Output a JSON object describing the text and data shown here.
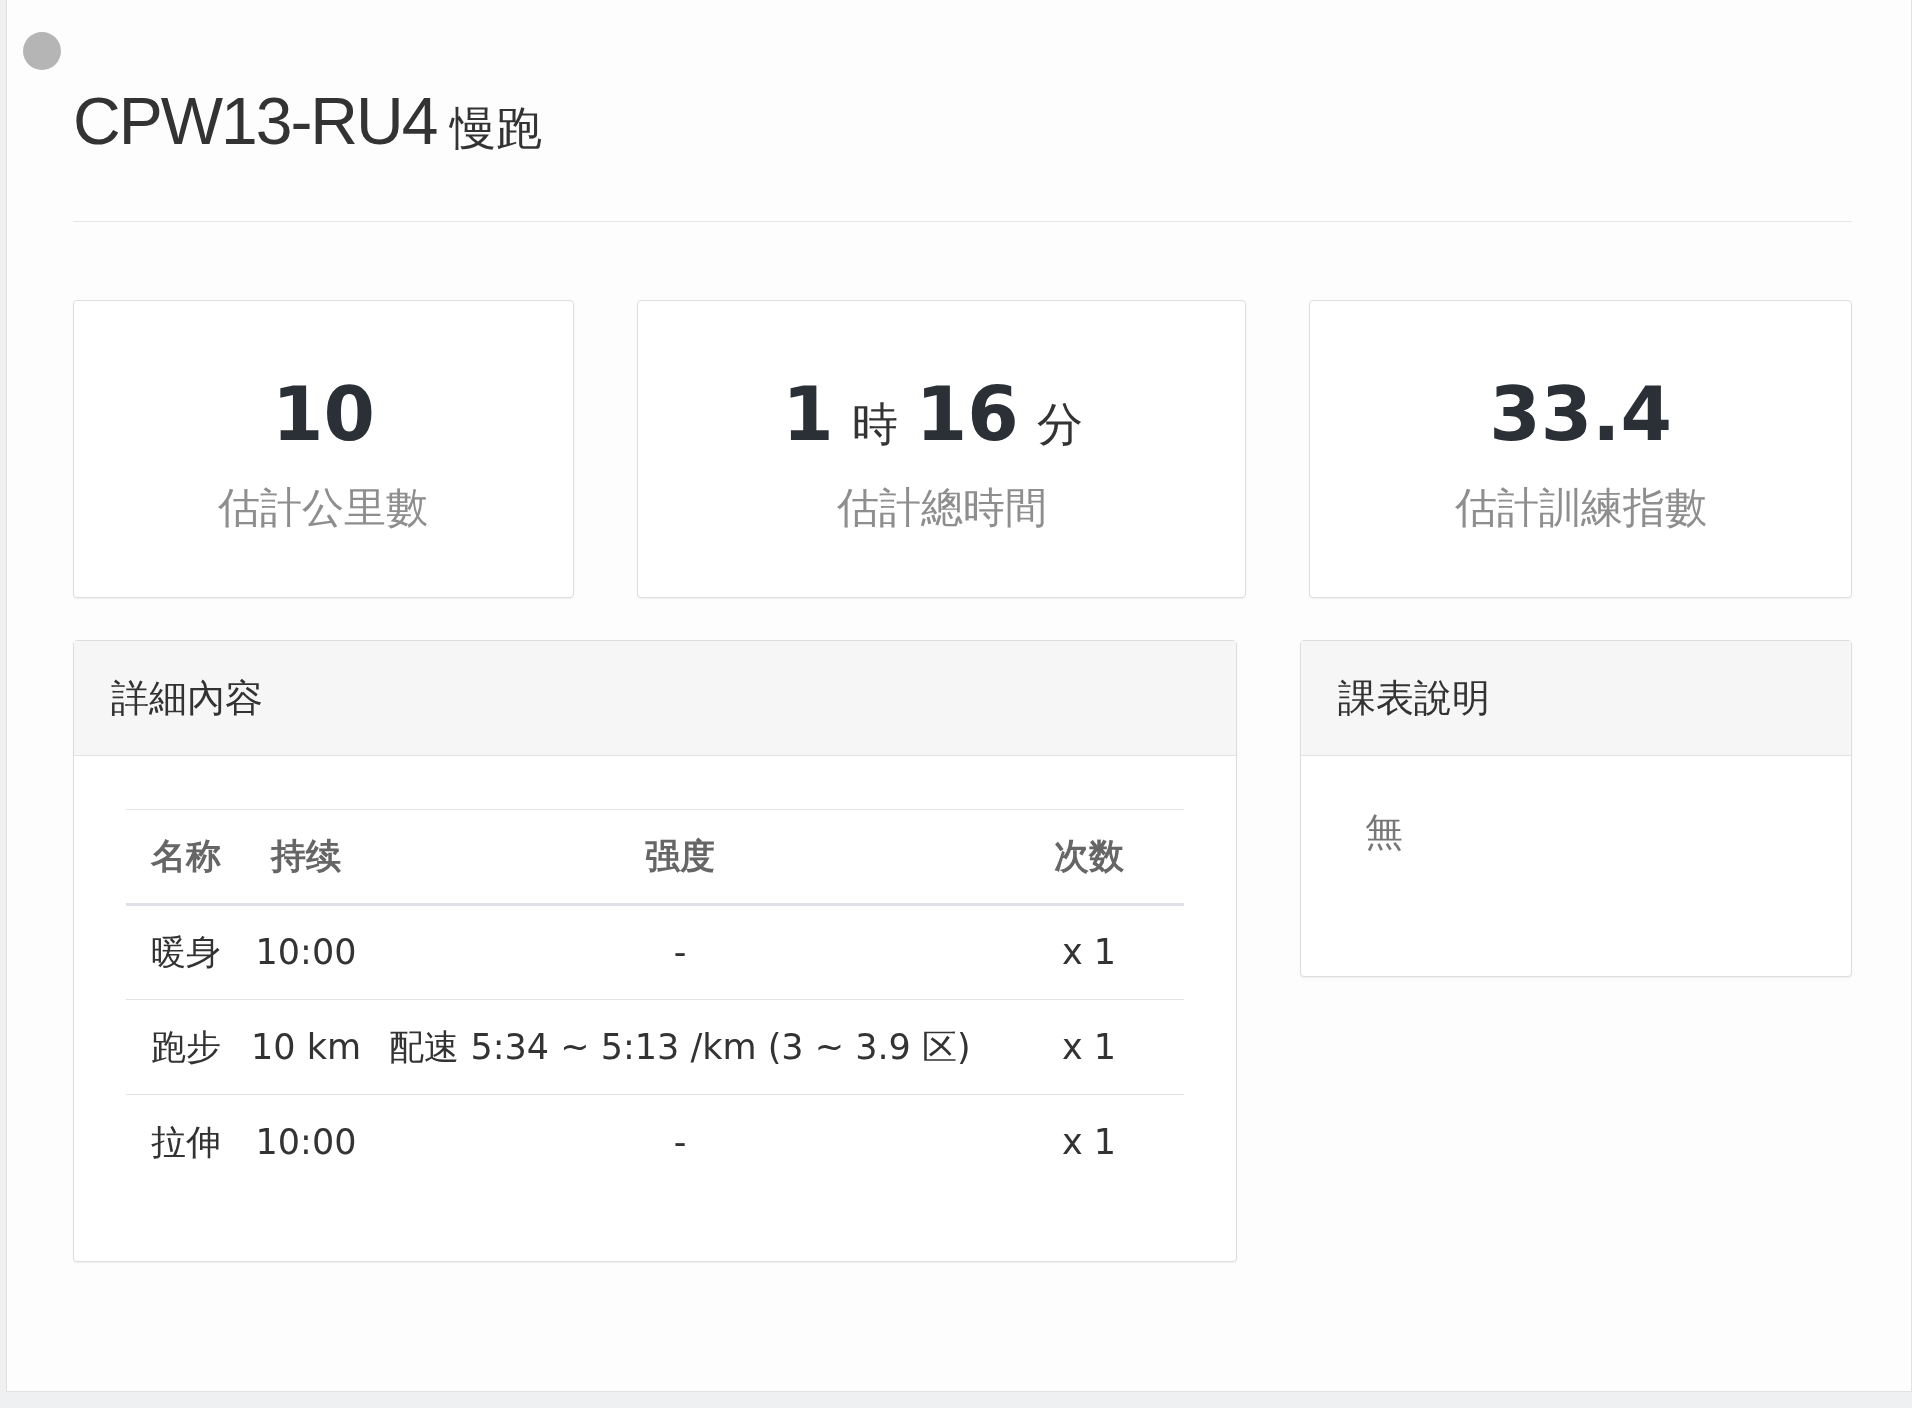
{
  "title": {
    "code": "CPW13-RU4",
    "name": "慢跑"
  },
  "stats": [
    {
      "parts": [
        {
          "kind": "number",
          "text": "10"
        }
      ],
      "label": "估計公里數"
    },
    {
      "parts": [
        {
          "kind": "number",
          "text": "1"
        },
        {
          "kind": "unit",
          "text": "時"
        },
        {
          "kind": "number",
          "text": "16"
        },
        {
          "kind": "unit",
          "text": "分"
        }
      ],
      "label": "估計總時間"
    },
    {
      "parts": [
        {
          "kind": "number",
          "text": "33.4"
        }
      ],
      "label": "估計訓練指數"
    }
  ],
  "details": {
    "title": "詳細內容",
    "columns": [
      "名称",
      "持续",
      "强度",
      "次数"
    ],
    "rows": [
      [
        "暖身",
        "10:00",
        "-",
        "x 1"
      ],
      [
        "跑步",
        "10 km",
        "配速 5:34 ~ 5:13 /km (3 ~ 3.9 区)",
        "x 1"
      ],
      [
        "拉伸",
        "10:00",
        "-",
        "x 1"
      ]
    ]
  },
  "notes": {
    "title": "課表說明",
    "text": "無"
  }
}
